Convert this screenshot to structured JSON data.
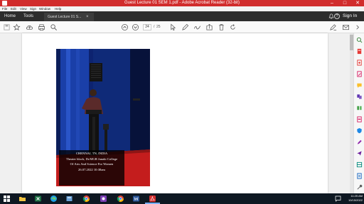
{
  "window": {
    "title": "Guest Lecture 01 SEM 1.pdf - Adobe Acrobat Reader (32-bit)",
    "controls": [
      "–",
      "□",
      "✕"
    ]
  },
  "menu": [
    "File",
    "Edit",
    "View",
    "Sign",
    "Window",
    "Help"
  ],
  "tabs": {
    "home": "Home",
    "tools": "Tools",
    "document": "Guest Lecture 01 S...",
    "close": "×",
    "help": "?",
    "signin": "Sign In"
  },
  "toolbar": {
    "page_current": "24",
    "page_separator": "/",
    "page_total": "25"
  },
  "photo_caption": {
    "line1": "CHENNAI, TN, INDIA",
    "line2": "Theater block, Dr.MGR Janaki College",
    "line3": "Of Arts And Science For Women",
    "line4": "26.07.2022 10:38am"
  },
  "taskbar": {
    "time": "11:25 AM",
    "date": "10/15/2022"
  },
  "colors": {
    "title_bar": "#d12c2c",
    "tab_strip": "#2d2d2d",
    "taskbar": "#0e1822",
    "stage_curtain": "#1a3fa8",
    "stage_floor": "#c41d1d"
  }
}
